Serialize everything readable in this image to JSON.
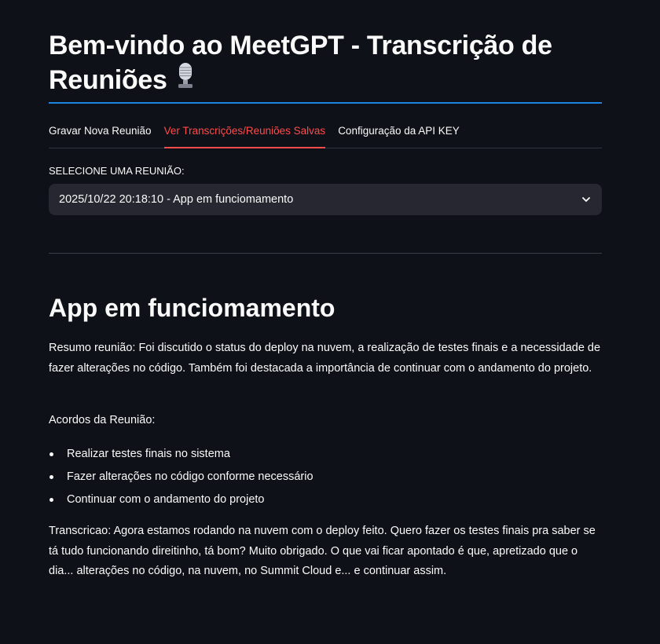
{
  "header": {
    "title": "Bem-vindo ao MeetGPT - Transcrição de Reuniões",
    "icon": "microphone-icon"
  },
  "tabs": [
    {
      "label": "Gravar Nova Reunião",
      "active": false
    },
    {
      "label": "Ver Transcrições/Reuniões Salvas",
      "active": true
    },
    {
      "label": "Configuração da API KEY",
      "active": false
    }
  ],
  "selector": {
    "label": "SELECIONE UMA REUNIÃO:",
    "selected_value": "2025/10/22 20:18:10 - App em funciomamento"
  },
  "meeting": {
    "title": "App em funciomamento",
    "summary": "Resumo reunião: Foi discutido o status do deploy na nuvem, a realização de testes finais e a necessidade de fazer alterações no código. Também foi destacada a importância de continuar com o andamento do projeto.",
    "agreements_label": "Acordos da Reunião:",
    "agreements": [
      "Realizar testes finais no sistema",
      "Fazer alterações no código conforme necessário",
      "Continuar com o andamento do projeto"
    ],
    "transcript": "Transcricao: Agora estamos rodando na nuvem com o deploy feito. Quero fazer os testes finais pra saber se tá tudo funcionando direitinho, tá bom? Muito obrigado. O que vai ficar apontado é que, apretizado que o dia... alterações no código, na nuvem, no Summit Cloud e... e continuar assim."
  },
  "colors": {
    "background": "#0e1117",
    "text": "#fafafa",
    "accent_active_tab": "#ff4b4b",
    "title_rule": "#1c83e1",
    "select_background": "#262730"
  }
}
